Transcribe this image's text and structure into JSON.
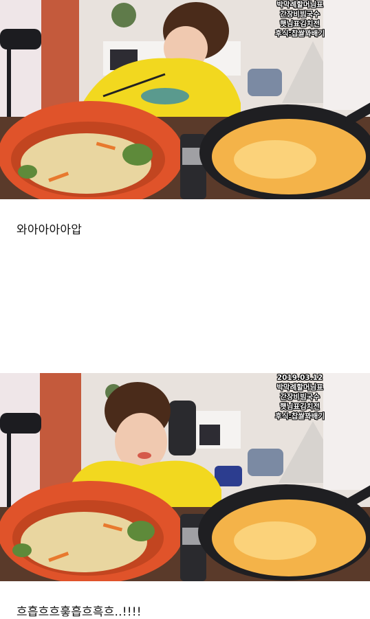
{
  "post": {
    "photo1": {
      "alt_scene": "woman eating noodles",
      "menu_lines": [
        "박막례할머님표",
        "간장비빔국수",
        "햇님표김치전",
        "후식:찹쌀꽈배기"
      ]
    },
    "caption1": "와아아아아압",
    "photo2": {
      "alt_scene": "woman smiling with noodles and pancake",
      "date": "2019.03.12",
      "menu_lines": [
        "박막례할머님표",
        "간장비빔국수",
        "햇님표김치전",
        "후식:찹쌀꽈배기"
      ]
    },
    "caption2": "흐흡흐흐흫흡흐흑흐..!!!!"
  },
  "colors": {
    "bowl": "#e0532a",
    "shirt": "#f2d81f",
    "pan": "#1f1f22",
    "pancake": "#f4b349",
    "noodle": "#e9d6a0"
  }
}
